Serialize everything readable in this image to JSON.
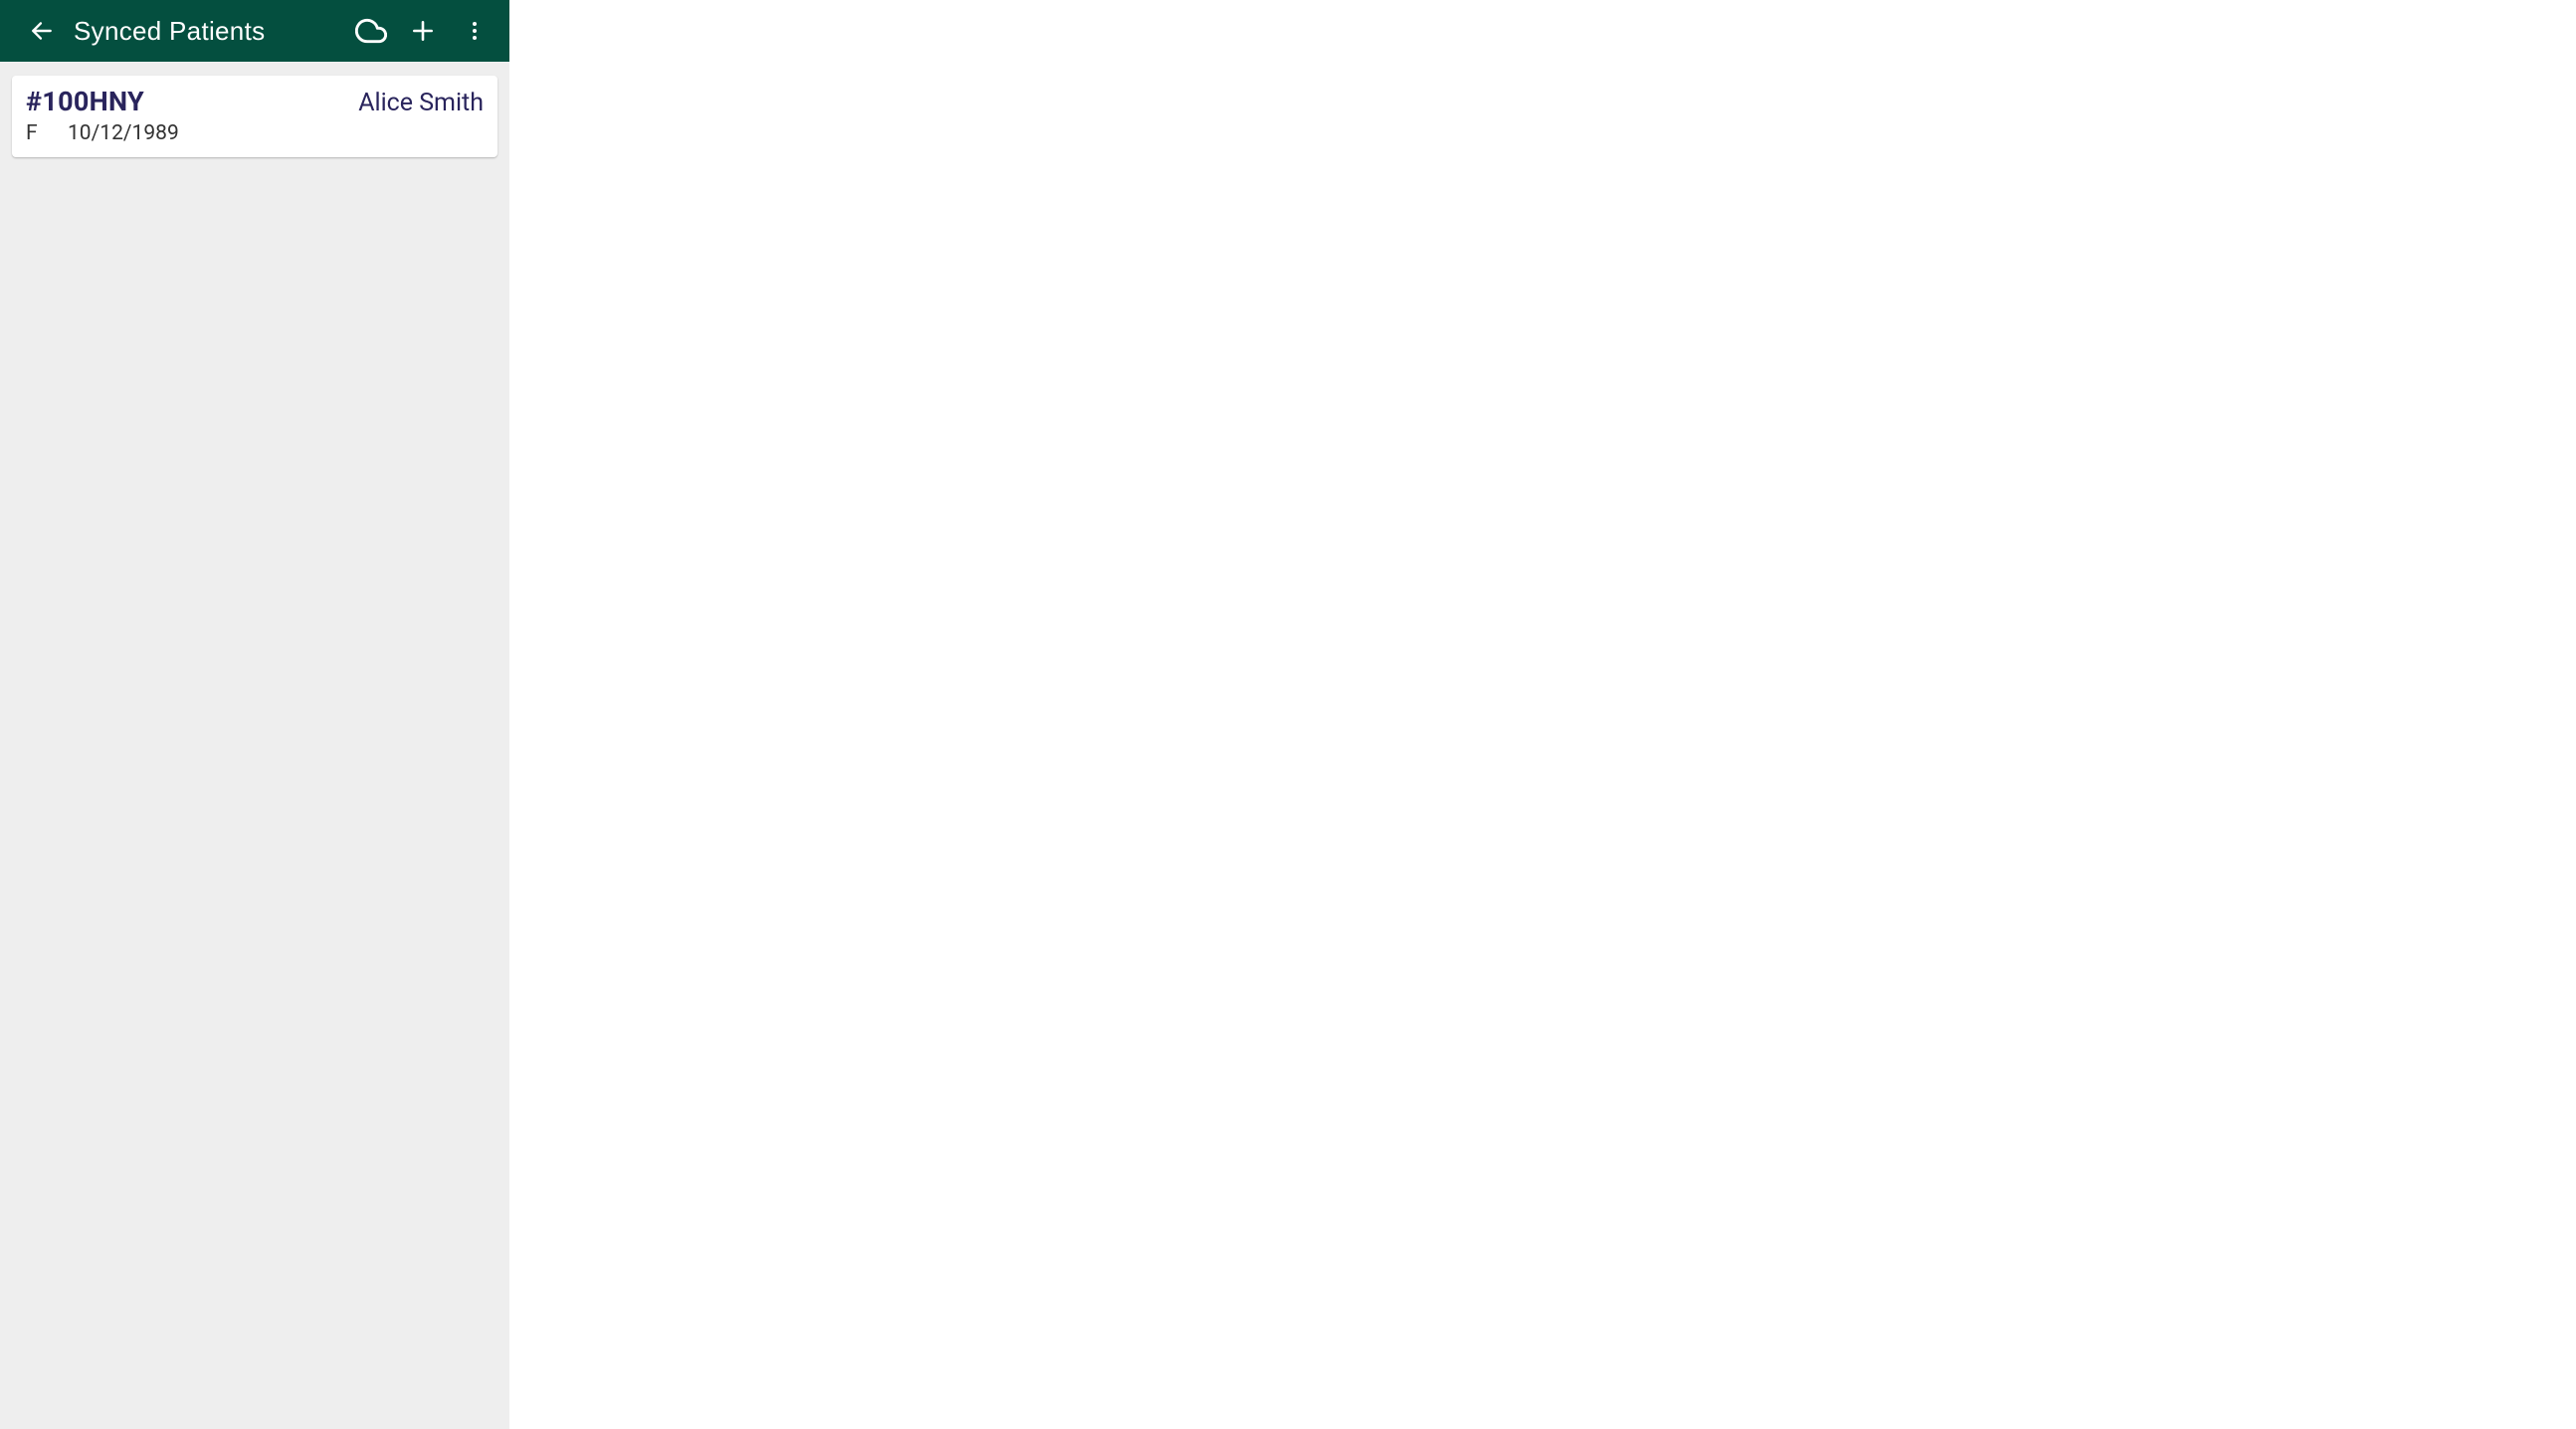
{
  "toolbar": {
    "title": "Synced Patients"
  },
  "patients": [
    {
      "id": "#100HNY",
      "name": "Alice Smith",
      "gender": "F",
      "dob": "10/12/1989"
    }
  ]
}
